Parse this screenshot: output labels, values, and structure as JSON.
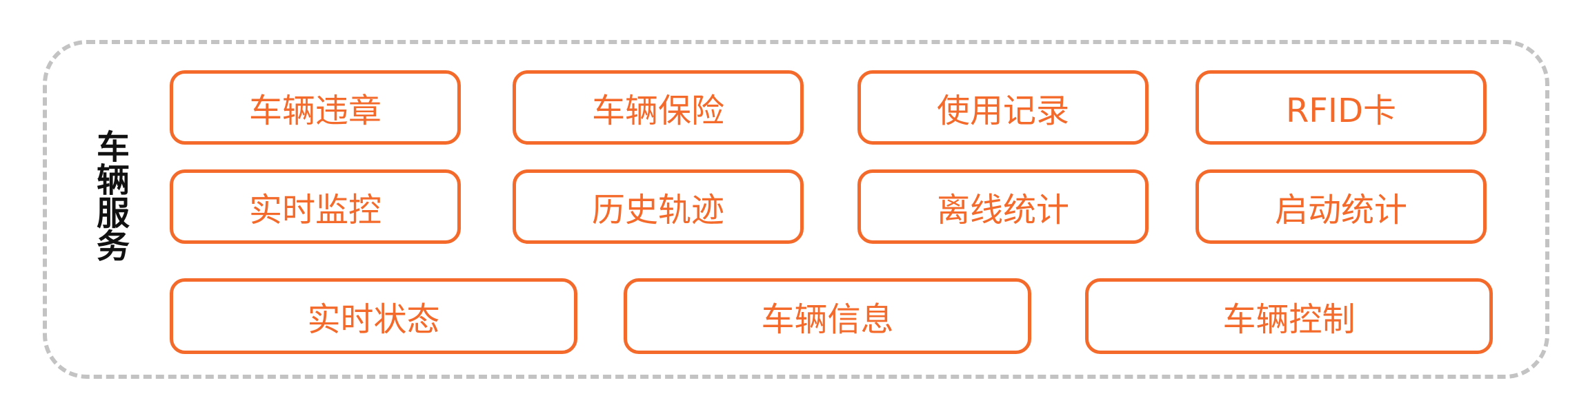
{
  "group": {
    "label": "车辆服务"
  },
  "modules": {
    "row1": [
      "车辆违章",
      "车辆保险",
      "使用记录",
      "RFID卡"
    ],
    "row2": [
      "实时监控",
      "历史轨迹",
      "离线统计",
      "启动统计"
    ],
    "row3": [
      "实时状态",
      "车辆信息",
      "车辆控制"
    ]
  },
  "colors": {
    "accent": "#f36a2b",
    "frame_dash": "#c3c3c3",
    "label_text": "#111111",
    "background": "#ffffff"
  }
}
